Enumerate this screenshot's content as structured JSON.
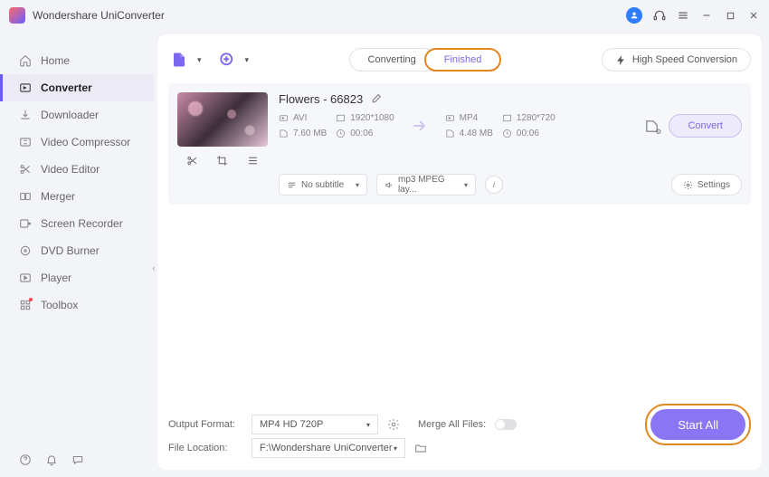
{
  "app_title": "Wondershare UniConverter",
  "sidebar": {
    "items": [
      {
        "label": "Home",
        "icon": "home"
      },
      {
        "label": "Converter",
        "icon": "converter",
        "active": true
      },
      {
        "label": "Downloader",
        "icon": "download"
      },
      {
        "label": "Video Compressor",
        "icon": "compress"
      },
      {
        "label": "Video Editor",
        "icon": "scissors"
      },
      {
        "label": "Merger",
        "icon": "merge"
      },
      {
        "label": "Screen Recorder",
        "icon": "record"
      },
      {
        "label": "DVD Burner",
        "icon": "dvd"
      },
      {
        "label": "Player",
        "icon": "play"
      },
      {
        "label": "Toolbox",
        "icon": "grid",
        "dot": true
      }
    ]
  },
  "tabs": {
    "converting": "Converting",
    "finished": "Finished"
  },
  "high_speed": "High Speed Conversion",
  "file": {
    "title": "Flowers - 66823",
    "src": {
      "format": "AVI",
      "res": "1920*1080",
      "size": "7.60 MB",
      "dur": "00:06"
    },
    "dst": {
      "format": "MP4",
      "res": "1280*720",
      "size": "4.48 MB",
      "dur": "00:06"
    },
    "convert_btn": "Convert",
    "subtitle": "No subtitle",
    "audio": "mp3 MPEG lay...",
    "settings": "Settings"
  },
  "footer": {
    "output_format_label": "Output Format:",
    "output_format_value": "MP4 HD 720P",
    "file_location_label": "File Location:",
    "file_location_value": "F:\\Wondershare UniConverter",
    "merge_label": "Merge All Files:",
    "start_all": "Start All"
  }
}
